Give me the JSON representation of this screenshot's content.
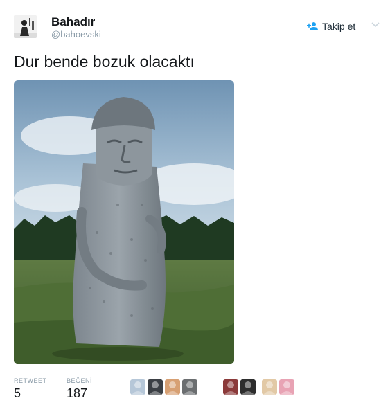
{
  "user": {
    "name": "Bahadır",
    "handle": "@bahoevski",
    "avatar_icon": "profile-photo"
  },
  "follow": {
    "label": "Takip et",
    "icon": "follow-user-icon"
  },
  "tweet": {
    "text": "Dur bende bozuk olacaktı",
    "media_icon": "photo-stone-statue"
  },
  "stats": {
    "retweet_label": "RETWEET",
    "retweet_count": "5",
    "like_label": "BEĞENİ",
    "like_count": "187"
  },
  "likers": [
    {
      "name": "liker-avatar-1",
      "color": "#b6c7d8"
    },
    {
      "name": "liker-avatar-2",
      "color": "#3b3f44"
    },
    {
      "name": "liker-avatar-3",
      "color": "#d7a073"
    },
    {
      "name": "liker-avatar-4",
      "color": "#6b6e70"
    },
    {
      "name": "liker-avatar-5",
      "color": "#8b3a3a"
    },
    {
      "name": "liker-avatar-6",
      "color": "#2d2d2d"
    },
    {
      "name": "liker-avatar-7",
      "color": "#e2c9a6"
    },
    {
      "name": "liker-avatar-8",
      "color": "#e8a3b4"
    }
  ],
  "colors": {
    "text": "#14171a",
    "muted": "#8899a6",
    "accent": "#1da1f2"
  }
}
